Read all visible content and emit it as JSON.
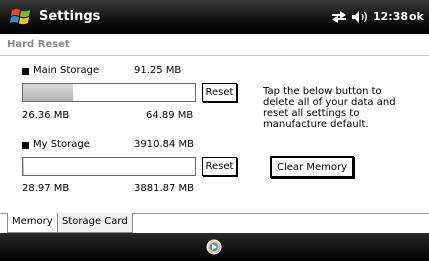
{
  "titlebar": {
    "app_title": "Settings",
    "time": "12:38",
    "ok_label": "ok",
    "icons": [
      "windows-start-icon",
      "connectivity-icon",
      "volume-icon"
    ]
  },
  "page": {
    "title": "Hard Reset"
  },
  "main_storage": {
    "label": "Main Storage",
    "total": "91.25 MB",
    "used": "26.36 MB",
    "free": "64.89 MB",
    "used_fraction": 0.289,
    "reset_label": "Reset"
  },
  "my_storage": {
    "label": "My Storage",
    "total": "3910.84 MB",
    "used": "28.97 MB",
    "free": "3881.87 MB",
    "used_fraction": 0.007,
    "reset_label": "Reset"
  },
  "info": {
    "text": "Tap the below button to delete all of your data and reset all settings to manufacture default.",
    "clear_label": "Clear Memory"
  },
  "tabs": [
    {
      "label": "Memory",
      "active": true
    },
    {
      "label": "Storage Card",
      "active": false
    }
  ],
  "bottombar": {
    "icons": [
      "input-panel-icon"
    ]
  }
}
